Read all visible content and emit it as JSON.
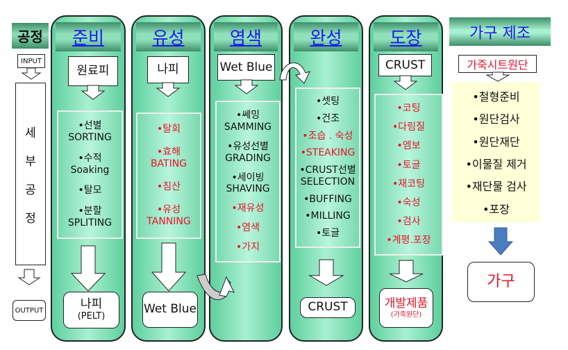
{
  "left": {
    "title": "공정",
    "input": "INPUT",
    "vertical": [
      "세",
      "부",
      "공",
      "정"
    ],
    "output": "OUTPUT"
  },
  "columns": [
    {
      "title": "준비",
      "input": "원료피",
      "items": [
        {
          "t": "•선별\nSORTING",
          "red": false
        },
        {
          "t": "•수적\nSoaking",
          "red": false
        },
        {
          "t": "•탈모",
          "red": false
        },
        {
          "t": "•분할\nSPLITING",
          "red": false
        }
      ],
      "output": "나피",
      "output_sub": "(PELT)"
    },
    {
      "title": "유성",
      "input": "나피",
      "items": [
        {
          "t": "•탈회",
          "red": true
        },
        {
          "t": "•효해\nBATING",
          "red": true
        },
        {
          "t": "•침산",
          "red": true
        },
        {
          "t": "•유성\nTANNING",
          "red": true
        }
      ],
      "output": "Wet Blue"
    },
    {
      "title": "염색",
      "input": "Wet Blue",
      "items": [
        {
          "t": "•쎄밍\nSAMMING",
          "red": false
        },
        {
          "t": "•유성선별\nGRADING",
          "red": false
        },
        {
          "t": "•세이빙\nSHAVING",
          "red": false
        },
        {
          "t": "•재유성",
          "red": true
        },
        {
          "t": "•염색",
          "red": true
        },
        {
          "t": "•가지",
          "red": true
        }
      ]
    },
    {
      "title": "완성",
      "items": [
        {
          "t": "•셋팅",
          "red": false
        },
        {
          "t": "•건조",
          "red": false
        },
        {
          "t": "•조습 . 숙성",
          "red": true
        },
        {
          "t": "•STEAKING",
          "red": true
        },
        {
          "t": "•CRUST선별\nSELECTION",
          "red": false
        },
        {
          "t": "•BUFFING",
          "red": false
        },
        {
          "t": "•MILLING",
          "red": false
        },
        {
          "t": "•토글",
          "red": false
        }
      ],
      "output": "CRUST"
    },
    {
      "title": "도장",
      "input": "CRUST",
      "items": [
        {
          "t": "•코팅",
          "red": true
        },
        {
          "t": "•다림질",
          "red": true
        },
        {
          "t": "•엠보",
          "red": true
        },
        {
          "t": "•토글",
          "red": true
        },
        {
          "t": "•재코팅",
          "red": true
        },
        {
          "t": "•숙성",
          "red": true
        },
        {
          "t": "•검사",
          "red": true
        },
        {
          "t": "•계평.포장",
          "red": true
        }
      ],
      "output": "개발제품",
      "output_sub": "(가죽원단)"
    }
  ],
  "furniture": {
    "title": "가구 제조",
    "input": "가죽시트원단",
    "items": [
      "•철형준비",
      "•원단검사",
      "•원단재단",
      "•이물질 제거",
      "•재단물 검사",
      "•포장"
    ],
    "output": "가구"
  },
  "colors": {
    "column": "#8fe0bb",
    "header_text": "#1a1aee",
    "red_text": "#e8142a",
    "furniture_panel": "#ffffd8",
    "blue_arrow": "#4a7cc0"
  }
}
